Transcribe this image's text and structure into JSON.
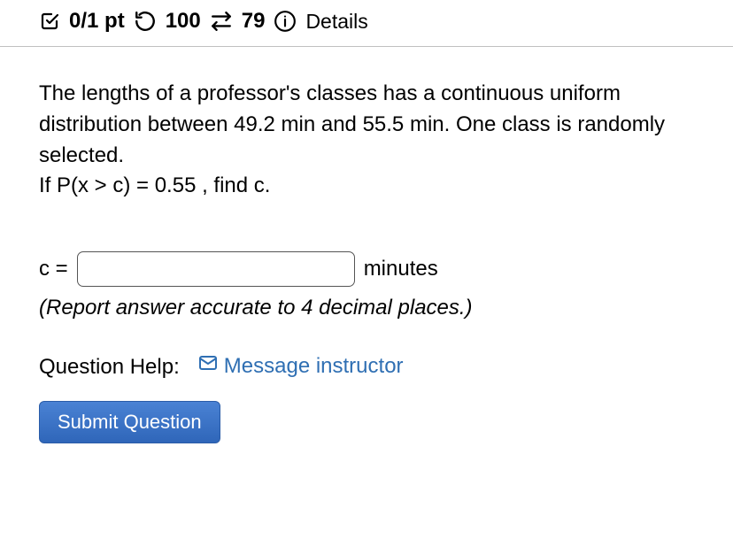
{
  "header": {
    "score": "0/1 pt",
    "retries": "100",
    "attempts_left": "79",
    "details_label": "Details"
  },
  "question": {
    "text_line1": "The lengths of a professor's classes has a continuous uniform distribution between 49.2 min and 55.5 min. One class is randomly selected.",
    "text_line2": "If P(x > c) = 0.55 , find c.",
    "answer_label": "c =",
    "answer_unit": "minutes",
    "hint": "(Report answer accurate to 4 decimal places.)"
  },
  "help": {
    "label": "Question Help:",
    "message_link": "Message instructor"
  },
  "submit_label": "Submit Question"
}
